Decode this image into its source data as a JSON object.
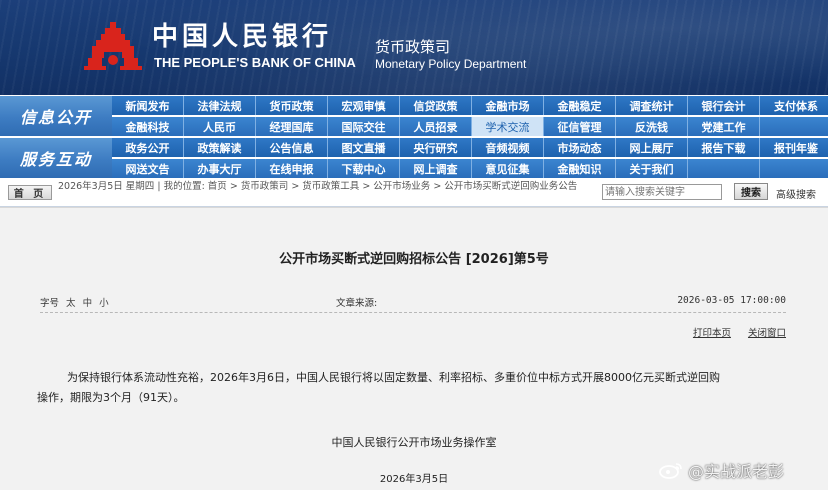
{
  "header": {
    "bank_name_cn": "中国人民银行",
    "bank_name_en": "THE PEOPLE'S BANK OF CHINA",
    "dept_cn": "货币政策司",
    "dept_en": "Monetary Policy Department",
    "bg_color": "#16386f"
  },
  "nav": {
    "label_1": "信息公开",
    "label_2": "服务互动",
    "rows": [
      [
        "新闻发布",
        "法律法规",
        "货币政策",
        "宏观审慎",
        "信贷政策",
        "金融市场",
        "金融稳定",
        "调查统计",
        "银行会计",
        "支付体系"
      ],
      [
        "金融科技",
        "人民币",
        "经理国库",
        "国际交往",
        "人员招录",
        "学术交流",
        "征信管理",
        "反洗钱",
        "党建工作",
        ""
      ],
      [
        "政务公开",
        "政策解读",
        "公告信息",
        "图文直播",
        "央行研究",
        "音频视频",
        "市场动态",
        "网上展厅",
        "报告下载",
        "报刊年鉴"
      ],
      [
        "网送文告",
        "办事大厅",
        "在线申报",
        "下载中心",
        "网上调查",
        "意见征集",
        "金融知识",
        "关于我们",
        "",
        ""
      ]
    ],
    "active_item": "学术交流"
  },
  "breadcrumb": {
    "home_label": "首 页",
    "date_text": "2026年3月5日 星期四",
    "location_label": "我的位置:",
    "path": "首页  >  货币政策司  >  货币政策工具  >  公开市场业务  >  公开市场买断式逆回购业务公告",
    "search_placeholder": "请输入搜索关键字",
    "search_button": "搜索",
    "advanced_search": "高级搜索"
  },
  "article": {
    "title": "公开市场买断式逆回购招标公告 [2026]第5号",
    "font_size_label": "字号",
    "font_sizes": [
      "太",
      "中",
      "小"
    ],
    "source_label": "文章来源:",
    "datetime": "2026-03-05 17:00:00",
    "print_label": "打印本页",
    "close_label": "关闭窗口",
    "body_line_1": "为保持银行体系流动性充裕，2026年3月6日，中国人民银行将以固定数量、利率招标、多重价位中标方式开展8000亿元买断式逆回购",
    "body_line_2": "操作，期限为3个月（91天）。",
    "signature": "中国人民银行公开市场业务操作室",
    "sign_date": "2026年3月5日"
  },
  "watermark": {
    "text": "@实战派老彭"
  }
}
